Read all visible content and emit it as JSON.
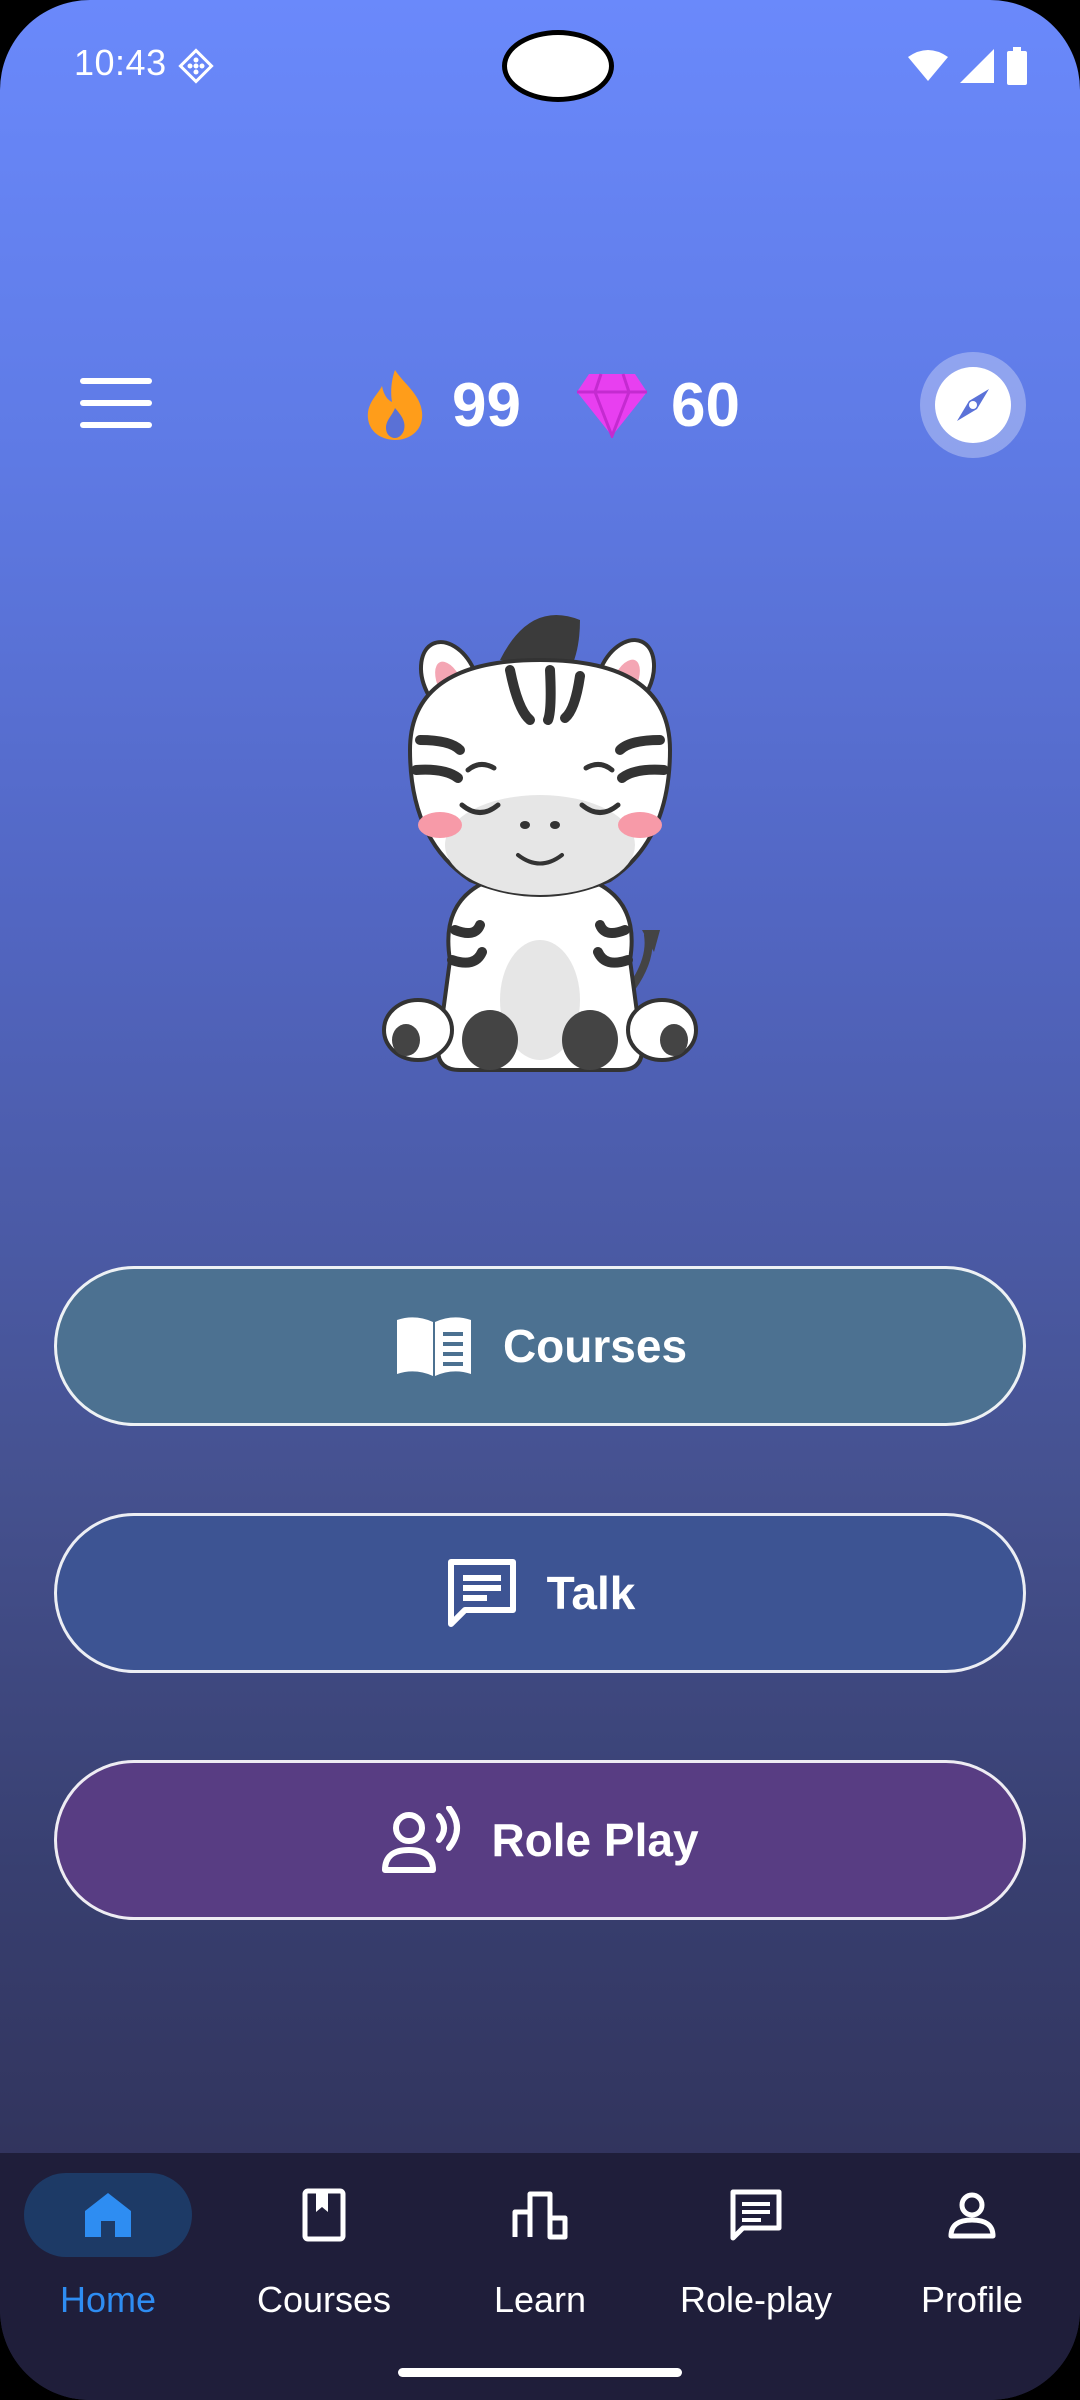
{
  "status_bar": {
    "time": "10:43",
    "icons": [
      "sim-status-icon",
      "wifi-icon",
      "cellular-signal-icon",
      "battery-icon"
    ]
  },
  "top_bar": {
    "menu_icon": "hamburger-menu-icon",
    "streak": {
      "icon": "flame-icon",
      "value": "99",
      "color": "#ff9d1a"
    },
    "gems": {
      "icon": "gem-icon",
      "value": "60",
      "color": "#e83ff0"
    },
    "explore_icon": "compass-icon"
  },
  "mascot": {
    "icon": "zebra-mascot"
  },
  "actions": [
    {
      "label": "Courses",
      "icon": "open-book-icon",
      "color": "#4c7191"
    },
    {
      "label": "Talk",
      "icon": "chat-bubble-icon",
      "color": "#3d5493"
    },
    {
      "label": "Role Play",
      "icon": "voice-person-icon",
      "color": "#583d83"
    }
  ],
  "bottom_nav": {
    "items": [
      {
        "label": "Home",
        "icon": "home-icon",
        "active": true
      },
      {
        "label": "Courses",
        "icon": "bookmark-book-icon",
        "active": false
      },
      {
        "label": "Learn",
        "icon": "leaderboard-icon",
        "active": false
      },
      {
        "label": "Role-play",
        "icon": "message-icon",
        "active": false
      },
      {
        "label": "Profile",
        "icon": "person-icon",
        "active": false
      }
    ],
    "active_color": "#2e8df2"
  }
}
